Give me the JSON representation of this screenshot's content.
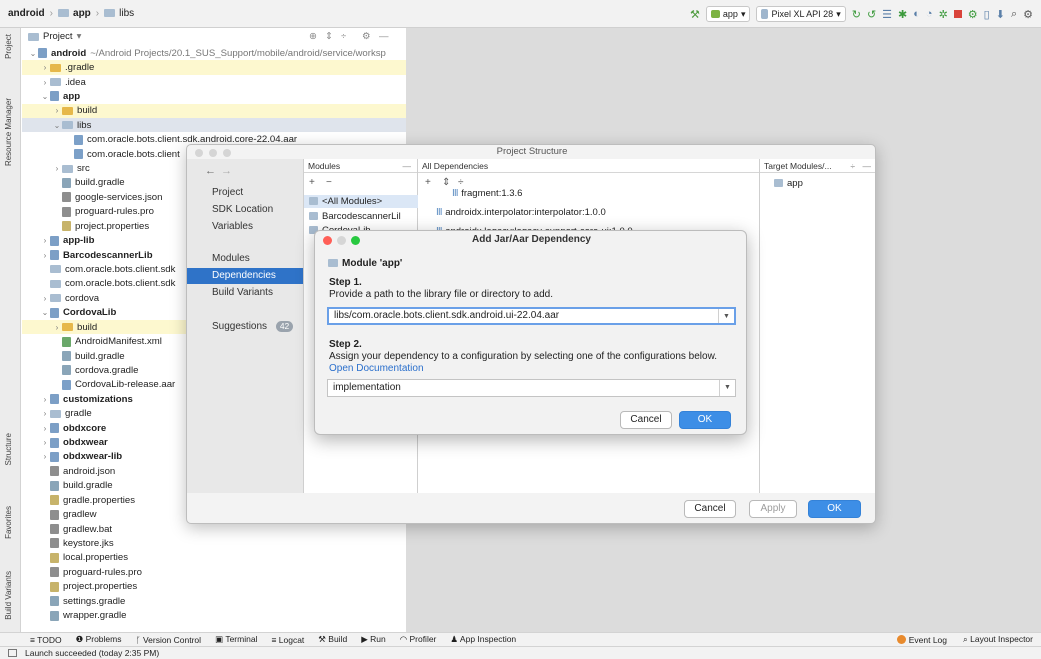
{
  "breadcrumb": {
    "items": [
      "android",
      "app",
      "libs"
    ]
  },
  "toolbar": {
    "run_config": "app",
    "device": "Pixel XL API 28"
  },
  "left_tool_tabs": [
    "Project",
    "Resource Manager",
    "Structure",
    "Favorites",
    "Build Variants"
  ],
  "project_panel": {
    "header": "Project",
    "tree": [
      {
        "label": "android",
        "suffix": "~/Android Projects/20.1_SUS_Support/mobile/android/service/worksp",
        "depth": 0,
        "chevron": "v",
        "icon": "module",
        "bold": true
      },
      {
        "label": ".gradle",
        "depth": 1,
        "chevron": ">",
        "icon": "folder-orange",
        "highlight": true
      },
      {
        "label": ".idea",
        "depth": 1,
        "chevron": ">",
        "icon": "folder"
      },
      {
        "label": "app",
        "depth": 1,
        "chevron": "v",
        "icon": "module",
        "bold": true
      },
      {
        "label": "build",
        "depth": 2,
        "chevron": ">",
        "icon": "folder-orange",
        "highlight": true
      },
      {
        "label": "libs",
        "depth": 2,
        "chevron": "v",
        "icon": "folder",
        "selected": true
      },
      {
        "label": "com.oracle.bots.client.sdk.android.core-22.04.aar",
        "depth": 3,
        "icon": "aar"
      },
      {
        "label": "com.oracle.bots.client",
        "depth": 3,
        "icon": "aar"
      },
      {
        "label": "src",
        "depth": 2,
        "chevron": ">",
        "icon": "folder"
      },
      {
        "label": "build.gradle",
        "depth": 2,
        "icon": "gradle"
      },
      {
        "label": "google-services.json",
        "depth": 2,
        "icon": "file"
      },
      {
        "label": "proguard-rules.pro",
        "depth": 2,
        "icon": "file"
      },
      {
        "label": "project.properties",
        "depth": 2,
        "icon": "props"
      },
      {
        "label": "app-lib",
        "depth": 1,
        "chevron": ">",
        "icon": "module",
        "bold": true
      },
      {
        "label": "BarcodescannerLib",
        "depth": 1,
        "chevron": ">",
        "icon": "module",
        "bold": true
      },
      {
        "label": "com.oracle.bots.client.sdk",
        "depth": 1,
        "icon": "folder"
      },
      {
        "label": "com.oracle.bots.client.sdk",
        "depth": 1,
        "icon": "folder"
      },
      {
        "label": "cordova",
        "depth": 1,
        "chevron": ">",
        "icon": "folder"
      },
      {
        "label": "CordovaLib",
        "depth": 1,
        "chevron": "v",
        "icon": "module",
        "bold": true
      },
      {
        "label": "build",
        "depth": 2,
        "chevron": ">",
        "icon": "folder-orange",
        "highlight": true
      },
      {
        "label": "AndroidManifest.xml",
        "depth": 2,
        "icon": "manifest"
      },
      {
        "label": "build.gradle",
        "depth": 2,
        "icon": "gradle"
      },
      {
        "label": "cordova.gradle",
        "depth": 2,
        "icon": "gradle"
      },
      {
        "label": "CordovaLib-release.aar",
        "depth": 2,
        "icon": "aar"
      },
      {
        "label": "customizations",
        "depth": 1,
        "chevron": ">",
        "icon": "module",
        "bold": true
      },
      {
        "label": "gradle",
        "depth": 1,
        "chevron": ">",
        "icon": "folder"
      },
      {
        "label": "obdxcore",
        "depth": 1,
        "chevron": ">",
        "icon": "module",
        "bold": true
      },
      {
        "label": "obdxwear",
        "depth": 1,
        "chevron": ">",
        "icon": "module",
        "bold": true
      },
      {
        "label": "obdxwear-lib",
        "depth": 1,
        "chevron": ">",
        "icon": "module",
        "bold": true
      },
      {
        "label": "android.json",
        "depth": 1,
        "icon": "file"
      },
      {
        "label": "build.gradle",
        "depth": 1,
        "icon": "gradle"
      },
      {
        "label": "gradle.properties",
        "depth": 1,
        "icon": "props"
      },
      {
        "label": "gradlew",
        "depth": 1,
        "icon": "file"
      },
      {
        "label": "gradlew.bat",
        "depth": 1,
        "icon": "file"
      },
      {
        "label": "keystore.jks",
        "depth": 1,
        "icon": "file"
      },
      {
        "label": "local.properties",
        "depth": 1,
        "icon": "props"
      },
      {
        "label": "proguard-rules.pro",
        "depth": 1,
        "icon": "file"
      },
      {
        "label": "project.properties",
        "depth": 1,
        "icon": "props"
      },
      {
        "label": "settings.gradle",
        "depth": 1,
        "icon": "gradle"
      },
      {
        "label": "wrapper.gradle",
        "depth": 1,
        "icon": "gradle"
      }
    ]
  },
  "bottom_tabs": [
    "TODO",
    "Problems",
    "Version Control",
    "Terminal",
    "Logcat",
    "Build",
    "Run",
    "Profiler",
    "App Inspection"
  ],
  "bottom_right_tabs": [
    "Event Log",
    "Layout Inspector"
  ],
  "status": "Launch succeeded (today 2:35 PM)",
  "project_structure": {
    "title": "Project Structure",
    "nav": [
      "Project",
      "SDK Location",
      "Variables",
      "Modules",
      "Dependencies",
      "Build Variants",
      "Suggestions"
    ],
    "active_nav": "Dependencies",
    "suggestions_count": "42",
    "modules_header": "Modules",
    "modules": [
      "<All Modules>",
      "BarcodescannerLil",
      "CordovaLib"
    ],
    "all_deps_header": "All Dependencies",
    "deps": [
      "fragment:1.3.6",
      "androidx.interpolator:interpolator:1.0.0",
      "androidx.legacy:legacy-support-core-ui:1.0.0"
    ],
    "target_header": "Target Modules/...",
    "targets": [
      "app"
    ],
    "cancel": "Cancel",
    "apply": "Apply",
    "ok": "OK"
  },
  "add_dependency": {
    "title": "Add Jar/Aar Dependency",
    "module": "Module 'app'",
    "step1_title": "Step 1.",
    "step1_text": "Provide a path to the library file or directory to add.",
    "path_value": "libs/com.oracle.bots.client.sdk.android.ui-22.04.aar",
    "step2_title": "Step 2.",
    "step2_text": "Assign your dependency to a configuration by selecting one of the configurations below.",
    "doc_link": "Open Documentation",
    "config_value": "implementation",
    "cancel": "Cancel",
    "ok": "OK"
  }
}
